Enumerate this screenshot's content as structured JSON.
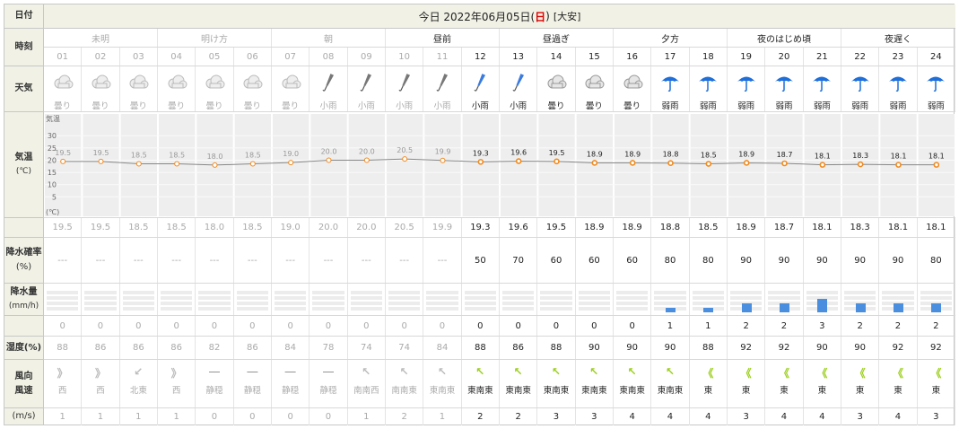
{
  "header": {
    "date_label": "日付",
    "title_prefix": "今日 2022年06月05日(",
    "weekday": "日",
    "title_suffix": ")",
    "rokuyo": "[大安]"
  },
  "labels": {
    "time": "時刻",
    "weather": "天気",
    "temp": "気温",
    "temp_unit": "(℃)",
    "rain_prob": "降水確率",
    "rain_prob_unit": "(%)",
    "rain_amount": "降水量",
    "rain_amount_unit": "(mm/h)",
    "humidity": "湿度(%)",
    "wind_dir": "風向",
    "wind_speed": "風速",
    "wind_unit": "(m/s)"
  },
  "periods": [
    "未明",
    "明け方",
    "朝",
    "昼前",
    "昼過ぎ",
    "夕方",
    "夜のはじめ頃",
    "夜遅く"
  ],
  "hours": [
    "01",
    "02",
    "03",
    "04",
    "05",
    "06",
    "07",
    "08",
    "09",
    "10",
    "11",
    "12",
    "13",
    "14",
    "15",
    "16",
    "17",
    "18",
    "19",
    "20",
    "21",
    "22",
    "23",
    "24"
  ],
  "past_count": 11,
  "weather": [
    {
      "icon": "cloud-icon",
      "label": "曇り"
    },
    {
      "icon": "cloud-icon",
      "label": "曇り"
    },
    {
      "icon": "cloud-icon",
      "label": "曇り"
    },
    {
      "icon": "cloud-icon",
      "label": "曇り"
    },
    {
      "icon": "cloud-icon",
      "label": "曇り"
    },
    {
      "icon": "cloud-icon",
      "label": "曇り"
    },
    {
      "icon": "cloud-icon",
      "label": "曇り"
    },
    {
      "icon": "closed-umbrella-icon",
      "label": "小雨"
    },
    {
      "icon": "closed-umbrella-icon",
      "label": "小雨"
    },
    {
      "icon": "closed-umbrella-icon",
      "label": "小雨"
    },
    {
      "icon": "closed-umbrella-icon",
      "label": "小雨"
    },
    {
      "icon": "closed-umbrella-icon",
      "label": "小雨"
    },
    {
      "icon": "closed-umbrella-icon",
      "label": "小雨"
    },
    {
      "icon": "cloud-icon",
      "label": "曇り"
    },
    {
      "icon": "cloud-icon",
      "label": "曇り"
    },
    {
      "icon": "cloud-icon",
      "label": "曇り"
    },
    {
      "icon": "open-umbrella-icon",
      "label": "弱雨"
    },
    {
      "icon": "open-umbrella-icon",
      "label": "弱雨"
    },
    {
      "icon": "open-umbrella-icon",
      "label": "弱雨"
    },
    {
      "icon": "open-umbrella-icon",
      "label": "弱雨"
    },
    {
      "icon": "open-umbrella-icon",
      "label": "弱雨"
    },
    {
      "icon": "open-umbrella-icon",
      "label": "弱雨"
    },
    {
      "icon": "open-umbrella-icon",
      "label": "弱雨"
    },
    {
      "icon": "open-umbrella-icon",
      "label": "弱雨"
    }
  ],
  "chart_data": {
    "type": "line",
    "title": "気温",
    "x": [
      "01",
      "02",
      "03",
      "04",
      "05",
      "06",
      "07",
      "08",
      "09",
      "10",
      "11",
      "12",
      "13",
      "14",
      "15",
      "16",
      "17",
      "18",
      "19",
      "20",
      "21",
      "22",
      "23",
      "24"
    ],
    "series": [
      {
        "name": "気温",
        "values": [
          19.5,
          19.5,
          18.5,
          18.5,
          18.0,
          18.5,
          19.0,
          20.0,
          20.0,
          20.5,
          19.9,
          19.3,
          19.6,
          19.5,
          18.9,
          18.9,
          18.8,
          18.5,
          18.9,
          18.7,
          18.1,
          18.3,
          18.1,
          18.1
        ]
      }
    ],
    "y_ticks": [
      "30",
      "25",
      "20",
      "15",
      "10",
      "5"
    ],
    "y_top_label": "気温",
    "y_bottom_label": "(℃)",
    "ylim": [
      0,
      33
    ],
    "line_color": "#888888",
    "point_color": "#f08a1e"
  },
  "temps": [
    "19.5",
    "19.5",
    "18.5",
    "18.5",
    "18.0",
    "18.5",
    "19.0",
    "20.0",
    "20.0",
    "20.5",
    "19.9",
    "19.3",
    "19.6",
    "19.5",
    "18.9",
    "18.9",
    "18.8",
    "18.5",
    "18.9",
    "18.7",
    "18.1",
    "18.3",
    "18.1",
    "18.1"
  ],
  "rain_prob": [
    "---",
    "---",
    "---",
    "---",
    "---",
    "---",
    "---",
    "---",
    "---",
    "---",
    "---",
    "50",
    "70",
    "60",
    "60",
    "60",
    "80",
    "80",
    "90",
    "90",
    "90",
    "90",
    "90",
    "80"
  ],
  "rain_amount": [
    0,
    0,
    0,
    0,
    0,
    0,
    0,
    0,
    0,
    0,
    0,
    0,
    0,
    0,
    0,
    0,
    1,
    1,
    2,
    2,
    3,
    2,
    2,
    2
  ],
  "humidity": [
    "88",
    "86",
    "86",
    "86",
    "82",
    "86",
    "84",
    "78",
    "74",
    "74",
    "84",
    "88",
    "86",
    "88",
    "90",
    "90",
    "90",
    "88",
    "92",
    "92",
    "90",
    "90",
    "92",
    "92"
  ],
  "wind_dir": [
    "西",
    "西",
    "北東",
    "西",
    "静穏",
    "静穏",
    "静穏",
    "静穏",
    "南南西",
    "南南東",
    "東南東",
    "東南東",
    "東南東",
    "東南東",
    "東南東",
    "東南東",
    "東南東",
    "東",
    "東",
    "東",
    "東",
    "東",
    "東",
    "東"
  ],
  "wind_speed": [
    "1",
    "1",
    "1",
    "1",
    "0",
    "0",
    "0",
    "0",
    "1",
    "2",
    "1",
    "2",
    "2",
    "3",
    "3",
    "4",
    "4",
    "4",
    "3",
    "4",
    "4",
    "3",
    "4",
    "3"
  ],
  "colors": {
    "header_bg": "#f1f1e6",
    "wind_arrow": "#9bcf1b",
    "bar": "#4a8ee0",
    "sunday": "#dd0000"
  }
}
